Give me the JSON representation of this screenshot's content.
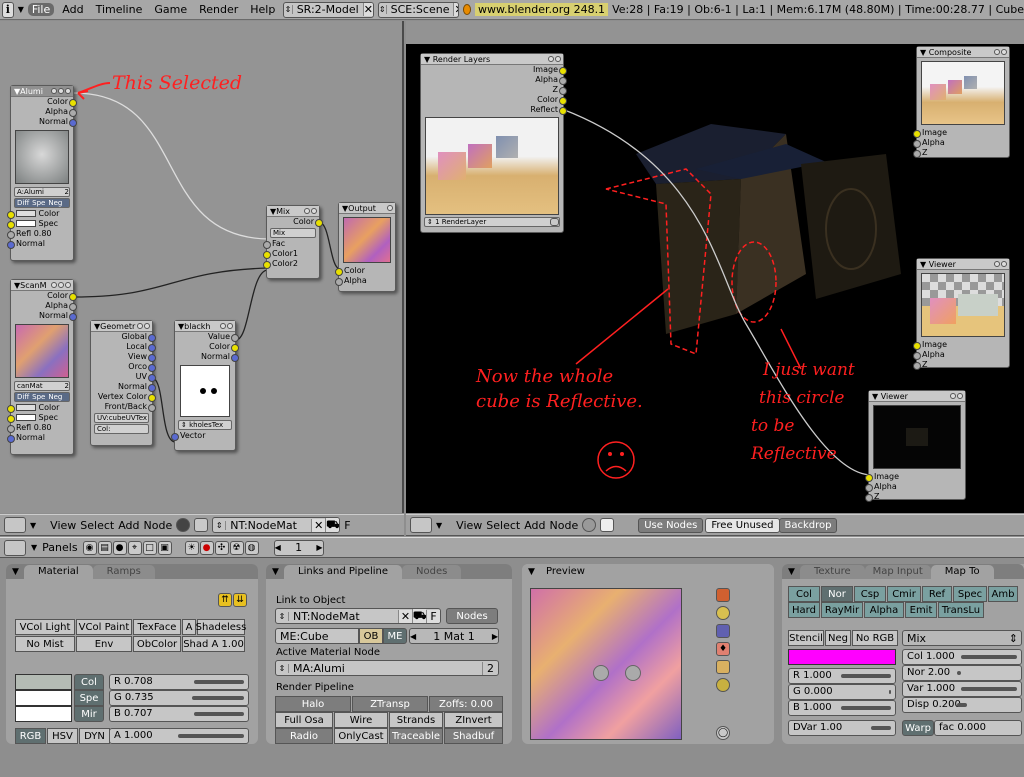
{
  "topbar": {
    "info_icon": "i",
    "menu": [
      "File",
      "Add",
      "Timeline",
      "Game",
      "Render",
      "Help"
    ],
    "screen": "SR:2-Model",
    "scene": "SCE:Scene",
    "url": "www.blender.org 248.1",
    "stats": "Ve:28 | Fa:19 | Ob:6-1 | La:1 | Mem:6.17M (48.80M) | Time:00:28.77 | Cube"
  },
  "nodeEditor": {
    "alumi": {
      "title": "Alumi",
      "outs": [
        "Color",
        "Alpha",
        "Normal"
      ],
      "mat": "A:Alumi",
      "mat_n": "2",
      "flags": [
        "Diff",
        "Spe",
        "Neg"
      ],
      "ins": [
        "Color",
        "Spec",
        "Refl 0.80",
        "Normal"
      ]
    },
    "scanm": {
      "title": "ScanM",
      "outs": [
        "Color",
        "Alpha",
        "Normal"
      ],
      "mat": "canMat",
      "mat_n": "2",
      "flags": [
        "Diff",
        "Spe",
        "Neg"
      ],
      "ins": [
        "Color",
        "Spec",
        "Refl 0.80",
        "Normal"
      ]
    },
    "geom": {
      "title": "Geometr",
      "outs": [
        "Global",
        "Local",
        "View",
        "Orco",
        "UV",
        "Normal",
        "Vertex Color",
        "Front/Back"
      ],
      "uv": "UV:cubeUVTex",
      "col": "Col:"
    },
    "blackh": {
      "title": "blackh",
      "outs": [
        "Value",
        "Color",
        "Normal"
      ],
      "tex": "kholesTex",
      "in": "Vector"
    },
    "mix": {
      "title": "Mix",
      "outs": [
        "Color"
      ],
      "mode": "Mix",
      "ins": [
        "Fac",
        "Color1",
        "Color2"
      ]
    },
    "output": {
      "title": "Output",
      "ins": [
        "Color",
        "Alpha"
      ]
    },
    "annotation": "This Selected",
    "header": {
      "menu": [
        "View",
        "Select",
        "Add",
        "Node"
      ],
      "tree": "NT:NodeMat",
      "f_label": "F"
    }
  },
  "compositor": {
    "renderLayers": {
      "title": "Render Layers",
      "outs": [
        "Image",
        "Alpha",
        "Z",
        "Color",
        "Reflect"
      ],
      "layer": "1 RenderLayer"
    },
    "composite": {
      "title": "Composite",
      "ins": [
        "Image",
        "Alpha",
        "Z"
      ]
    },
    "viewer1": {
      "title": "Viewer",
      "ins": [
        "Image",
        "Alpha",
        "Z"
      ]
    },
    "viewer2": {
      "title": "Viewer",
      "ins": [
        "Image",
        "Alpha",
        "Z"
      ]
    },
    "notes": {
      "left": [
        "Now the whole",
        "cube is Reflective."
      ],
      "right": [
        "I just want",
        "this circle",
        "to be",
        "Reflective"
      ]
    },
    "header": {
      "menu": [
        "View",
        "Select",
        "Add",
        "Node"
      ],
      "use_nodes": "Use Nodes",
      "free_unused": "Free Unused",
      "backdrop": "Backdrop"
    }
  },
  "buttons": {
    "panels_label": "Panels",
    "frame": "1",
    "material": {
      "tabs": [
        "Material",
        "Ramps"
      ],
      "row1": [
        "VCol Light",
        "VCol Paint",
        "TexFace",
        "A",
        "Shadeless"
      ],
      "row2": [
        "No Mist",
        "Env",
        "ObColor",
        "Shad A 1.00"
      ],
      "col_btns": [
        "Col",
        "Spe",
        "Mir"
      ],
      "sliders": [
        "R 0.708",
        "G 0.735",
        "B 0.707",
        "A 1.000"
      ],
      "models": [
        "RGB",
        "HSV",
        "DYN"
      ]
    },
    "links": {
      "tabs": [
        "Links and Pipeline",
        "Nodes"
      ],
      "link_label": "Link to Object",
      "nt": "NT:NodeMat",
      "f": "F",
      "nodes_btn": "Nodes",
      "me": "ME:Cube",
      "ob": "OB",
      "me_btn": "ME",
      "mat_num": "1 Mat 1",
      "active_label": "Active Material Node",
      "ma": "MA:Alumi",
      "ma_n": "2",
      "pipeline_label": "Render Pipeline",
      "p1": [
        "Halo",
        "ZTransp",
        "Zoffs: 0.00"
      ],
      "p2": [
        "Full Osa",
        "Wire",
        "Strands",
        "ZInvert"
      ],
      "p3": [
        "Radio",
        "OnlyCast",
        "Traceable",
        "Shadbuf"
      ]
    },
    "preview": {
      "title": "Preview"
    },
    "texture": {
      "tabs": [
        "Texture",
        "Map Input",
        "Map To"
      ],
      "row1": [
        "Col",
        "Nor",
        "Csp",
        "Cmir",
        "Ref",
        "Spec",
        "Amb"
      ],
      "row2": [
        "Hard",
        "RayMir",
        "Alpha",
        "Emit",
        "TransLu"
      ],
      "row3": [
        "Stencil",
        "Neg",
        "No RGB"
      ],
      "blend": "Mix",
      "rgb": [
        "R 1.000",
        "G 0.000",
        "B 1.000"
      ],
      "right": [
        "Col 1.000",
        "Nor 2.00",
        "Var 1.000",
        "Disp 0.200"
      ],
      "dvar": "DVar 1.00",
      "warp": "Warp",
      "fac": "fac 0.000"
    }
  },
  "colors": {
    "red": "#ff2020",
    "magenta": "#ff00ff",
    "black_view": "#000000",
    "socket_yellow": "#e8e000",
    "socket_blue": "#5a6ad0"
  }
}
